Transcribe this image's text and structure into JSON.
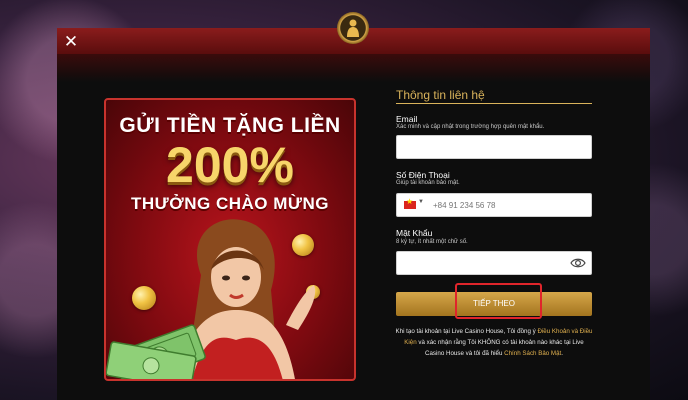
{
  "header": {
    "close_icon": "close-icon",
    "logo_icon": "casino-lady-logo-icon"
  },
  "promo": {
    "line1": "GỬI TIỀN TẶNG LIỀN",
    "percent": "200%",
    "line3": "THƯỞNG CHÀO MỪNG"
  },
  "form": {
    "title": "Thông tin liên hệ",
    "email": {
      "label": "Email",
      "hint": "Xác minh và cập nhật trong trường hợp quên mật khẩu.",
      "value": ""
    },
    "phone": {
      "label": "Số Điện Thoại",
      "hint": "Giúp tài khoản bảo mật.",
      "country_flag": "vietnam-flag-icon",
      "placeholder": "+84 91 234 56 78"
    },
    "password": {
      "label": "Mật Khẩu",
      "hint": "8 ký tự, ít nhất một chữ số.",
      "value": "",
      "toggle_icon": "eye-icon"
    },
    "submit_label": "TIẾP THEO",
    "terms": {
      "part1": "Khi tạo tài khoản tại Live Casino House, Tôi đồng ý ",
      "link1": "Điều Khoản và Điều Kiện",
      "part2": " và xác nhận rằng Tôi KHÔNG có tài khoản nào khác tại Live Casino House và tôi đã hiểu ",
      "link2": "Chính Sách Bảo Mật",
      "part3": "."
    }
  },
  "colors": {
    "accent_gold": "#d9b35b",
    "header_red": "#8a1c1c",
    "highlight_red": "#e0252b"
  }
}
